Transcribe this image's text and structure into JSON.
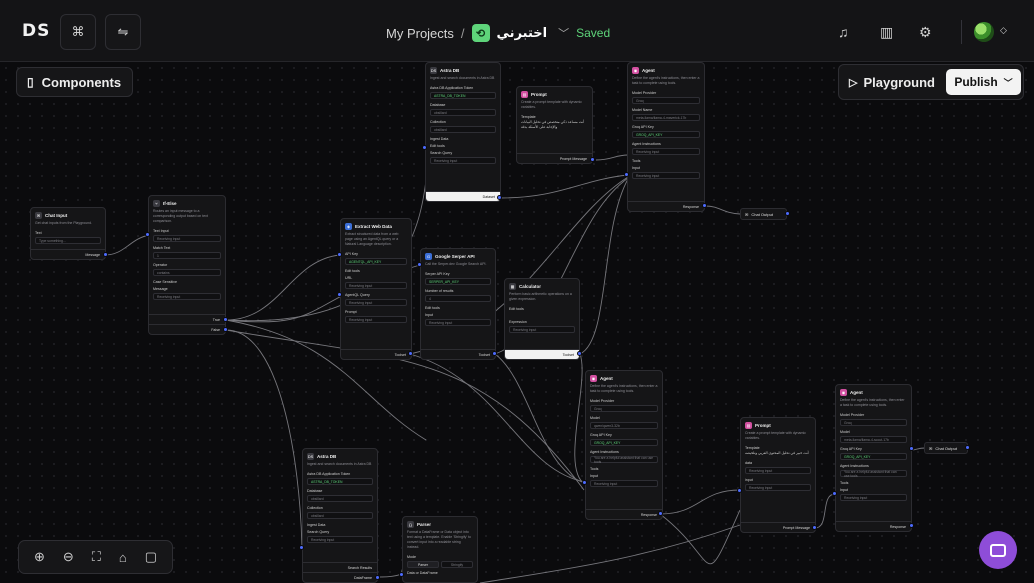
{
  "topbar": {
    "logo": "DS",
    "breadcrumb_root": "My Projects",
    "separator": "/",
    "project_name": "اختبرني",
    "saved_status": "Saved",
    "left_icons": [
      "hierarchy-icon",
      "swap-icon"
    ],
    "right_icons": [
      "bell-icon",
      "book-icon",
      "gear-icon"
    ]
  },
  "canvas": {
    "components_label": "Components",
    "playground_label": "Playground",
    "publish_label": "Publish",
    "zoom_icons": [
      "zoom-in-icon",
      "zoom-out-icon",
      "fit-view-icon",
      "unlock-icon",
      "note-icon"
    ],
    "accent": "#4d6cff"
  },
  "nodes": {
    "chat_input": {
      "title": "Chat Input",
      "desc": "Get chat inputs from the Playground.",
      "label_text": "Text",
      "placeholder": "Type something...",
      "output": "Message"
    },
    "if_else": {
      "title": "If-Else",
      "desc": "Routes an input message to a corresponding output based on text comparison.",
      "text_input": "Text Input",
      "text_input_val": "Receiving input",
      "match_text": "Match Text",
      "match_val": "1",
      "operator": "Operator",
      "operator_val": "contains",
      "case": "Case Sensitive",
      "message": "Message",
      "message_val": "Receiving input",
      "out_true": "True",
      "out_false": "False"
    },
    "astra_top": {
      "title": "Astra DB",
      "desc": "Ingest and search documents in Astra DB",
      "token": "Astra DB Application Token",
      "token_val": "ASTRA_DB_TOKEN",
      "db": "Database",
      "db_val": "obsillard",
      "coll": "Collection",
      "coll_val": "obsillard",
      "ingest": "Ingest Data",
      "edit": "Edit tools",
      "search": "Search Query",
      "search_val": "Receiving input",
      "output": "Dataset"
    },
    "prompt_top": {
      "title": "Prompt",
      "desc": "Create a prompt template with dynamic variables.",
      "template": "Template",
      "template_val": "أنت مساعد ذكي متخصص في تحليل البيانات والإجابة على الأسئلة بدقة",
      "output": "Prompt Message"
    },
    "agent_top": {
      "title": "Agent",
      "desc": "Define the agent's instructions, then enter a task to complete using tools.",
      "provider": "Model Provider",
      "provider_val": "Groq",
      "model": "Model Name",
      "model_val": "meta-llama/llama-4-maverick-17b",
      "key": "Groq API Key",
      "key_val": "GROQ_API_KEY",
      "instr": "Agent Instructions",
      "instr_val": "Receiving input",
      "tools": "Tools",
      "input": "Input",
      "input_val": "Receiving input",
      "output": "Response"
    },
    "chat_output_top": {
      "title": "Chat Output"
    },
    "extract_web": {
      "title": "Extract Web Data",
      "desc": "Extract structured data from a web page using an AgentQL query or a Natural Language description.",
      "key": "API Key",
      "key_val": "AGENTQL_API_KEY",
      "edit": "Edit tools",
      "url": "URL",
      "url_val": "Receiving input",
      "query": "AgentQL Query",
      "query_val": "Receiving input",
      "prompt": "Prompt",
      "prompt_val": "Receiving input",
      "output": "Toolset"
    },
    "serper": {
      "title": "Google Serper API",
      "desc": "Call the Serper.dev Google Search API.",
      "key": "Serper API Key",
      "key_val": "SERPER_API_KEY",
      "results": "Number of results",
      "results_val": "4",
      "edit": "Edit tools",
      "input": "Input",
      "input_val": "Receiving input",
      "output": "Toolset"
    },
    "calculator": {
      "title": "Calculator",
      "desc": "Perform basic arithmetic operations on a given expression.",
      "edit": "Edit tools",
      "expr": "Expression",
      "expr_val": "Receiving input",
      "output": "Toolset"
    },
    "agent_mid": {
      "title": "Agent",
      "desc": "Define the agent's instructions, then enter a task to complete using tools.",
      "provider": "Model Provider",
      "provider_val": "Groq",
      "model": "Model",
      "model_val": "qwen/qwen3-32b",
      "key": "Groq API Key",
      "key_val": "GROQ_API_KEY",
      "instr": "Agent Instructions",
      "instr_val": "You are a helpful assistant that can use tools",
      "tools": "Tools",
      "input": "Input",
      "input_val": "Receiving input",
      "output": "Response"
    },
    "prompt_mid": {
      "title": "Prompt",
      "desc": "Create a prompt template with dynamic variables.",
      "template": "Template",
      "template_val": "أنت خبير في تحليل المحتوى العربي وتلخيصه",
      "var1": "data",
      "var1_val": "Receiving input",
      "var2": "input",
      "var2_val": "Receiving input",
      "output": "Prompt Message"
    },
    "agent_right": {
      "title": "Agent",
      "desc": "Define the agent's instructions, then enter a task to complete using tools.",
      "provider": "Model Provider",
      "provider_val": "Groq",
      "model": "Model",
      "model_val": "meta-llama/llama-4-scout-17b",
      "key": "Groq API Key",
      "key_val": "GROQ_API_KEY",
      "instr": "Agent Instructions",
      "instr_val": "You are a helpful assistant that can use tools",
      "tools": "Tools",
      "input": "Input",
      "input_val": "Receiving input",
      "output": "Response"
    },
    "chat_output_right": {
      "title": "Chat Output"
    },
    "astra_bottom": {
      "title": "Astra DB",
      "desc": "Ingest and search documents in Astra DB",
      "token": "Astra DB Application Token",
      "token_val": "ASTRA_DB_TOKEN",
      "db": "Database",
      "db_val": "obsillard",
      "coll": "Collection",
      "coll_val": "obsillard",
      "ingest": "Ingest Data",
      "search": "Search Query",
      "search_val": "Receiving input",
      "out1": "Search Results",
      "out2": "DataFrame"
    },
    "parser": {
      "title": "Parser",
      "desc": "Format a DataFrame or Data object into text using a template. Enable 'Stringify' to convert input into a readable string instead.",
      "mode": "Mode",
      "mode_a": "Parser",
      "mode_b": "Stringify",
      "data": "Data or DataFrame"
    }
  }
}
